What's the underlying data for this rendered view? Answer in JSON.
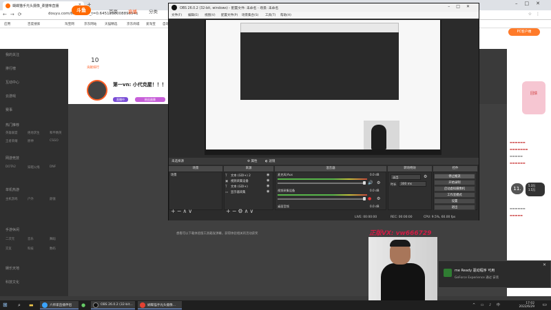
{
  "browser": {
    "tab_title": "蝴蝶猫手光头摄像_柔猫咪直播",
    "url": "douyu.com/6539991?_t=0.6451238008898541",
    "bookmarks": [
      "应用",
      "百度搜索",
      "淘宝网",
      "京东网站",
      "天猫精选",
      "京东商城",
      "爱淘宝",
      "自动拍卖"
    ]
  },
  "douyu": {
    "logo": "斗鱼",
    "nav": {
      "home": "首页",
      "live": "直播",
      "category": "分类"
    },
    "rank_value": "10",
    "rank_label": "贡献排行",
    "room_title": "第一vn: 小代克屋！！！",
    "badge1": "直播中",
    "badge2": "粉丝勋章",
    "pc_client": "PC客户端",
    "sidebar": {
      "items": [
        "我的关注",
        "排行榜",
        "互动中心",
        "云游戏",
        "赛事"
      ],
      "sections": [
        "热门推荐",
        "网游竞技",
        "单机热游",
        "手游休闲",
        "娱乐天地",
        "科技文化"
      ],
      "subs": [
        "英雄联盟",
        "绝地求生",
        "和平精英",
        "王者荣耀",
        "原神",
        "CSGO",
        "DOTA2",
        "穿越火线",
        "DNF",
        "主机游戏",
        "户外",
        "颜值",
        "二次元",
        "音乐",
        "舞蹈",
        "交友",
        "科技",
        "数码"
      ]
    },
    "player_hint": "想看可以下载体验版工具箱发弹幕，获得体验相关的活动获奖",
    "overlay_text": "正版VX: vw666729",
    "gift_label": "回馈",
    "viewer_bubble": "11.",
    "mini_stat": [
      "5.3万",
      "1.5万"
    ]
  },
  "obs": {
    "title": "OBS 26.0.2 (32-bit, windows) - 配置文件: 未命名 - 场景: 未命名",
    "menu": [
      "文件(F)",
      "编辑(E)",
      "视图(V)",
      "配置文件(P)",
      "场景集合(S)",
      "工具(T)",
      "帮助(H)"
    ],
    "no_source": "未选择源",
    "props": "属性",
    "filters": "滤镜",
    "docks": {
      "scenes": "场景",
      "sources": "来源",
      "mixer": "混音器",
      "transitions": "转场特效",
      "controls": "控件"
    },
    "scene_item": "场景",
    "sources": [
      {
        "icon": "T",
        "name": "文本 (GDI+) 2"
      },
      {
        "icon": "▣",
        "name": "视频采集设备"
      },
      {
        "icon": "T",
        "name": "文本 (GDI+)"
      },
      {
        "icon": "▭",
        "name": "显示器采集"
      }
    ],
    "mixer": [
      {
        "name": "麦克风/Aux",
        "db": "0.0 dB"
      },
      {
        "name": "视频采集设备",
        "db": "0.0 dB"
      },
      {
        "name": "桌面音频",
        "db": "0.0 dB"
      }
    ],
    "transition": {
      "type": "淡出",
      "duration_label": "时长",
      "duration": "300 ms"
    },
    "controls": [
      "停止推流",
      "开始录制",
      "启动虚拟摄像机",
      "工作室模式",
      "设置",
      "退出"
    ],
    "status": {
      "live": "LIVE: 00:00:00",
      "rec": "REC: 00:00:00",
      "cpu": "CPU: 9.5%, 60.00 fps"
    }
  },
  "notification": {
    "title": "me Ready 驱动程序 可用",
    "sub": "GeForce Experience 通过 安装"
  },
  "taskbar": {
    "apps": [
      "六师家直播伴侣",
      "OBS 26.0.2 (32-bit...",
      "蝴蝶猫手光头摄像..."
    ],
    "time": "17:02",
    "date": "2022/6/29"
  }
}
